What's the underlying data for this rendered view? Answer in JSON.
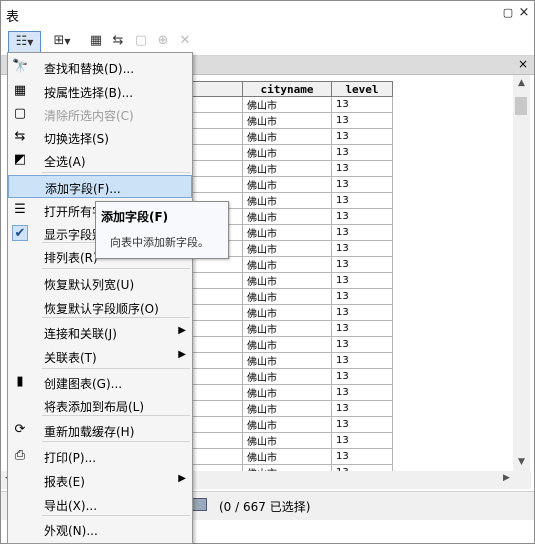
{
  "window": {
    "title": "表",
    "pin_icon": "pin-icon",
    "close_label": "×"
  },
  "toolbar": {
    "icons": [
      "table-options-icon",
      "related-tables-icon",
      "select-by-attributes-icon",
      "switch-selection-icon",
      "clear-selection-icon",
      "zoom-to-selected-icon",
      "delete-selected-icon"
    ]
  },
  "tab": {
    "close_label": "×"
  },
  "table": {
    "columns": [
      "",
      "cityname",
      "level"
    ],
    "rows": [
      [
        "",
        "佛山市",
        "13"
      ],
      [
        "",
        "佛山市",
        "13"
      ],
      [
        "",
        "佛山市",
        "13"
      ],
      [
        "",
        "佛山市",
        "13"
      ],
      [
        "",
        "佛山市",
        "13"
      ],
      [
        "",
        "佛山市",
        "13"
      ],
      [
        "",
        "佛山市",
        "13"
      ],
      [
        "",
        "佛山市",
        "13"
      ],
      [
        "",
        "佛山市",
        "13"
      ],
      [
        "",
        "佛山市",
        "13"
      ],
      [
        "",
        "佛山市",
        "13"
      ],
      [
        "",
        "佛山市",
        "13"
      ],
      [
        "",
        "佛山市",
        "13"
      ],
      [
        "",
        "佛山市",
        "13"
      ],
      [
        "",
        "佛山市",
        "13"
      ],
      [
        "",
        "佛山市",
        "13"
      ],
      [
        "",
        "佛山市",
        "13"
      ],
      [
        "",
        "佛山市",
        "13"
      ],
      [
        "",
        "佛山市",
        "13"
      ],
      [
        "",
        "佛山市",
        "13"
      ],
      [
        "",
        "佛山市",
        "13"
      ],
      [
        "",
        "佛山市",
        "13"
      ],
      [
        "",
        "佛山市",
        "13"
      ],
      [
        "",
        "佛山市",
        "13"
      ],
      [
        "",
        "佛山市",
        "13"
      ],
      [
        "",
        "佛山市",
        "13"
      ]
    ]
  },
  "status": {
    "selection_count": "(0 / 667 已选择)"
  },
  "menu": {
    "items": [
      {
        "label": "查找和替换(D)...",
        "icon": "binoculars-icon",
        "glyph": "🔭"
      },
      {
        "label": "按属性选择(B)...",
        "icon": "select-by-attributes-icon",
        "glyph": "▦"
      },
      {
        "label": "清除所选内容(C)",
        "icon": "clear-selection-icon",
        "glyph": "▢"
      },
      {
        "label": "切换选择(S)",
        "icon": "switch-selection-icon",
        "glyph": "⇆"
      },
      {
        "label": "全选(A)",
        "icon": "select-all-icon",
        "glyph": "◩"
      },
      {
        "label": "添加字段(F)...",
        "icon": "",
        "glyph": ""
      },
      {
        "label": "打开所有字段",
        "icon": "fields-icon",
        "glyph": "☰"
      },
      {
        "label": "显示字段别名",
        "icon": "checkmark-icon",
        "glyph": "✔"
      },
      {
        "label": "排列表(R)",
        "icon": "",
        "glyph": ""
      },
      {
        "label": "恢复默认列宽(U)",
        "icon": "",
        "glyph": ""
      },
      {
        "label": "恢复默认字段顺序(O)",
        "icon": "",
        "glyph": ""
      },
      {
        "label": "连接和关联(J)",
        "icon": "",
        "glyph": ""
      },
      {
        "label": "关联表(T)",
        "icon": "",
        "glyph": ""
      },
      {
        "label": "创建图表(G)...",
        "icon": "bar-chart-icon",
        "glyph": "▮"
      },
      {
        "label": "将表添加到布局(L)",
        "icon": "",
        "glyph": ""
      },
      {
        "label": "重新加载缓存(H)",
        "icon": "reload-icon",
        "glyph": "⟳"
      },
      {
        "label": "打印(P)...",
        "icon": "printer-icon",
        "glyph": "⎙"
      },
      {
        "label": "报表(E)",
        "icon": "",
        "glyph": ""
      },
      {
        "label": "导出(X)...",
        "icon": "",
        "glyph": ""
      },
      {
        "label": "外观(N)...",
        "icon": "",
        "glyph": ""
      }
    ],
    "submenu_arrow": "▶"
  },
  "tooltip": {
    "title": "添加字段(F)",
    "description": "向表中添加新字段。"
  },
  "colors": {
    "highlight": "#cce2f6",
    "highlight_border": "#7aa7d8"
  }
}
